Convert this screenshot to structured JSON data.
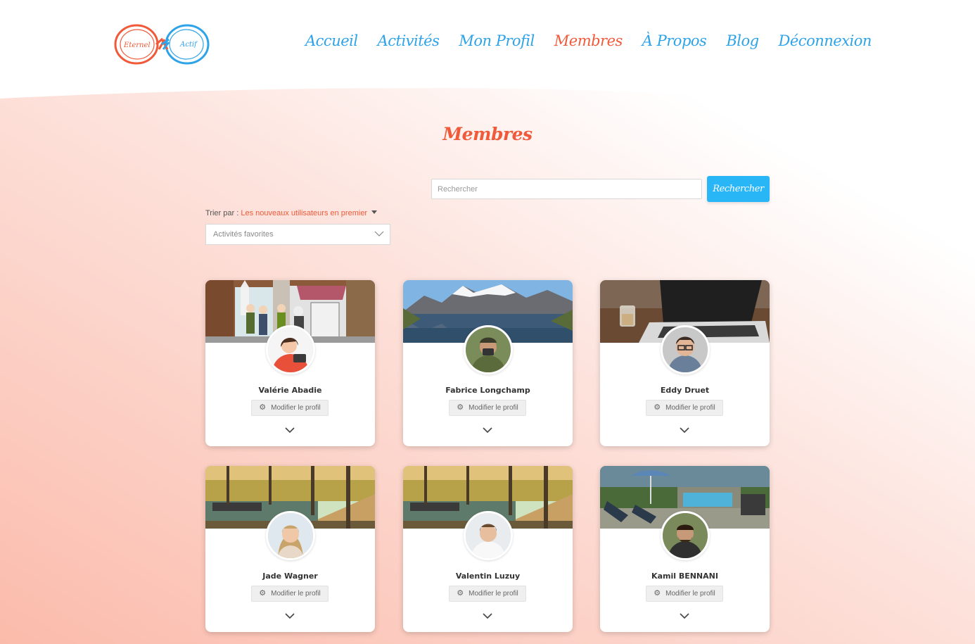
{
  "brand": {
    "logo_text_left": "Eternel",
    "logo_text_right": "Actif",
    "primary_color": "#f05a3a",
    "secondary_color": "#2ea3e8"
  },
  "nav": {
    "items": [
      {
        "label": "Accueil"
      },
      {
        "label": "Activités"
      },
      {
        "label": "Mon Profil"
      },
      {
        "label": "Membres"
      },
      {
        "label": "À Propos"
      },
      {
        "label": "Blog"
      },
      {
        "label": "Déconnexion"
      }
    ],
    "active": "Membres"
  },
  "page": {
    "title": "Membres"
  },
  "search": {
    "placeholder": "Rechercher",
    "button_label": "Rechercher"
  },
  "sort": {
    "label": "Trier par : ",
    "value": "Les nouveaux utilisateurs en premier"
  },
  "filter": {
    "placeholder": "Activités favorites"
  },
  "members": [
    {
      "name": "Valérie Abadie",
      "edit_label": "Modifier le profil",
      "cover": "village-illustration",
      "avatar": "woman-laptop-illustration"
    },
    {
      "name": "Fabrice Longchamp",
      "edit_label": "Modifier le profil",
      "cover": "mountain-lake",
      "avatar": "man-camera"
    },
    {
      "name": "Eddy Druet",
      "edit_label": "Modifier le profil",
      "cover": "laptop-desk",
      "avatar": "man-glasses"
    },
    {
      "name": "Jade Wagner",
      "edit_label": "Modifier le profil",
      "cover": "canal-trees",
      "avatar": "woman-smiling"
    },
    {
      "name": "Valentin Luzuy",
      "edit_label": "Modifier le profil",
      "cover": "canal-trees",
      "avatar": "man-white-tshirt"
    },
    {
      "name": "Kamil BENNANI",
      "edit_label": "Modifier le profil",
      "cover": "pool-garden",
      "avatar": "man-beard"
    }
  ]
}
